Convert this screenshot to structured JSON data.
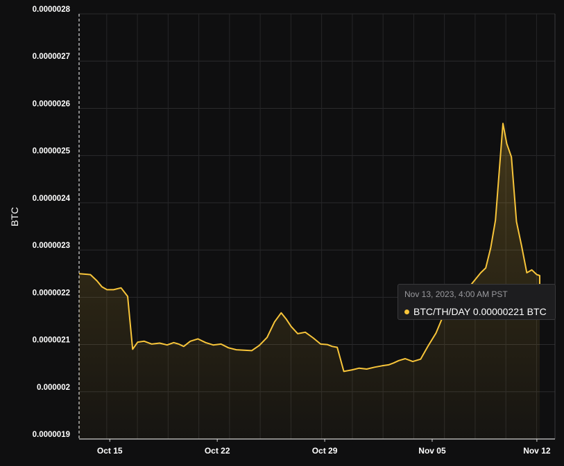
{
  "chart_data": {
    "type": "area",
    "ylabel": "BTC",
    "xlabel": "",
    "title": "",
    "y_ticks": [
      "0.0000019",
      "0.000002",
      "0.0000021",
      "0.0000022",
      "0.0000023",
      "0.0000024",
      "0.0000025",
      "0.0000026",
      "0.0000027",
      "0.0000028"
    ],
    "ylim": [
      1.9e-06,
      2.8e-06
    ],
    "x_ticks": [
      "Oct 15",
      "Oct 22",
      "Oct 29",
      "Nov 05",
      "Nov 12"
    ],
    "x_start": "2023-10-13",
    "x_end": "2023-11-13",
    "grid": true,
    "line_color": "#f8c53a",
    "series": [
      {
        "name": "BTC/TH/DAY",
        "points": [
          [
            "2023-10-13",
            2.25e-06
          ],
          [
            "2023-10-13",
            2.248e-06
          ],
          [
            "2023-10-14",
            2.235e-06
          ],
          [
            "2023-10-14",
            2.222e-06
          ],
          [
            "2023-10-14",
            2.216e-06
          ],
          [
            "2023-10-15",
            2.216e-06
          ],
          [
            "2023-10-15",
            2.22e-06
          ],
          [
            "2023-10-16",
            2.202e-06
          ],
          [
            "2023-10-16",
            2.09e-06
          ],
          [
            "2023-10-16",
            2.105e-06
          ],
          [
            "2023-10-17",
            2.107e-06
          ],
          [
            "2023-10-17",
            2.101e-06
          ],
          [
            "2023-10-18",
            2.103e-06
          ],
          [
            "2023-10-18",
            2.099e-06
          ],
          [
            "2023-10-19",
            2.104e-06
          ],
          [
            "2023-10-19",
            2.101e-06
          ],
          [
            "2023-10-19",
            2.096e-06
          ],
          [
            "2023-10-20",
            2.107e-06
          ],
          [
            "2023-10-20",
            2.112e-06
          ],
          [
            "2023-10-21",
            2.104e-06
          ],
          [
            "2023-10-21",
            2.099e-06
          ],
          [
            "2023-10-22",
            2.101e-06
          ],
          [
            "2023-10-22",
            2.093e-06
          ],
          [
            "2023-10-23",
            2.089e-06
          ],
          [
            "2023-10-23",
            2.088e-06
          ],
          [
            "2023-10-24",
            2.087e-06
          ],
          [
            "2023-10-24",
            2.098e-06
          ],
          [
            "2023-10-25",
            2.115e-06
          ],
          [
            "2023-10-25",
            2.148e-06
          ],
          [
            "2023-10-26",
            2.167e-06
          ],
          [
            "2023-10-26",
            2.154e-06
          ],
          [
            "2023-10-26",
            2.138e-06
          ],
          [
            "2023-10-27",
            2.123e-06
          ],
          [
            "2023-10-27",
            2.126e-06
          ],
          [
            "2023-10-28",
            2.114e-06
          ],
          [
            "2023-10-28",
            2.101e-06
          ],
          [
            "2023-10-29",
            2.1e-06
          ],
          [
            "2023-10-29",
            2.096e-06
          ],
          [
            "2023-10-29",
            2.094e-06
          ],
          [
            "2023-10-30",
            2.043e-06
          ],
          [
            "2023-10-30",
            2.046e-06
          ],
          [
            "2023-10-31",
            2.05e-06
          ],
          [
            "2023-10-31",
            2.048e-06
          ],
          [
            "2023-11-01",
            2.052e-06
          ],
          [
            "2023-11-01",
            2.055e-06
          ],
          [
            "2023-11-02",
            2.057e-06
          ],
          [
            "2023-11-02",
            2.061e-06
          ],
          [
            "2023-11-02",
            2.066e-06
          ],
          [
            "2023-11-03",
            2.07e-06
          ],
          [
            "2023-11-03",
            2.064e-06
          ],
          [
            "2023-11-04",
            2.069e-06
          ],
          [
            "2023-11-04",
            2.097e-06
          ],
          [
            "2023-11-05",
            2.124e-06
          ],
          [
            "2023-11-05",
            2.162e-06
          ],
          [
            "2023-11-06",
            2.192e-06
          ],
          [
            "2023-11-06",
            2.211e-06
          ],
          [
            "2023-11-07",
            2.219e-06
          ],
          [
            "2023-11-07",
            2.225e-06
          ],
          [
            "2023-11-07",
            2.238e-06
          ],
          [
            "2023-11-08",
            2.252e-06
          ],
          [
            "2023-11-08",
            2.262e-06
          ],
          [
            "2023-11-08",
            2.305e-06
          ],
          [
            "2023-11-09",
            2.363e-06
          ],
          [
            "2023-11-09",
            2.466e-06
          ],
          [
            "2023-11-09",
            2.568e-06
          ],
          [
            "2023-11-09",
            2.525e-06
          ],
          [
            "2023-11-10",
            2.497e-06
          ],
          [
            "2023-11-10",
            2.36e-06
          ],
          [
            "2023-11-10",
            2.31e-06
          ],
          [
            "2023-11-11",
            2.252e-06
          ],
          [
            "2023-11-11",
            2.258e-06
          ],
          [
            "2023-11-11",
            2.248e-06
          ],
          [
            "2023-11-12",
            2.246e-06
          ],
          [
            "2023-11-12",
            2.239e-06
          ],
          [
            "2023-11-12",
            2.245e-06
          ],
          [
            "2023-11-13",
            2.221e-06
          ]
        ]
      }
    ]
  },
  "tooltip": {
    "date": "Nov 13, 2023, 4:00 AM PST",
    "series_label": "BTC/TH/DAY",
    "value": "0.00000221 BTC",
    "row_text": "BTC/TH/DAY 0.00000221 BTC"
  }
}
